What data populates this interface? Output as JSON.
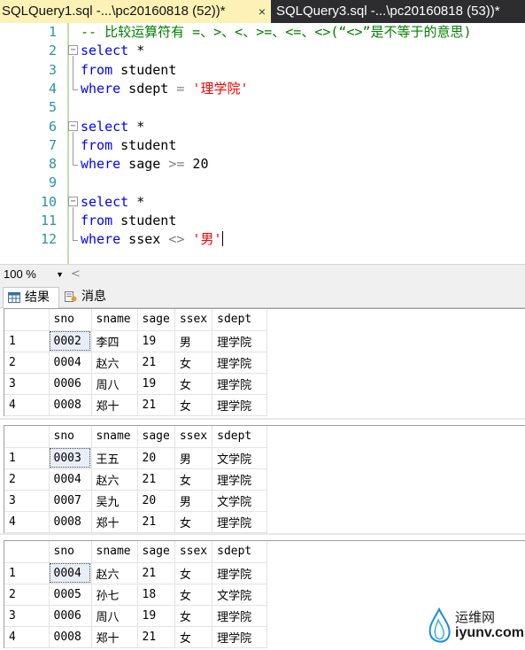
{
  "tabs": {
    "active": "SQLQuery1.sql -...\\pc20160818 (52))*",
    "close": "×",
    "inactive": "SQLQuery3.sql -...\\pc20160818 (53))*"
  },
  "editor": {
    "lines": [
      {
        "n": "1",
        "text": "-- 比较运算符有 =、>、<、>=、<=、<>(“<>”是不等于的意思)"
      },
      {
        "n": "2",
        "kw": "select",
        "rest": " *"
      },
      {
        "n": "3",
        "kw": "from",
        "rest": " student"
      },
      {
        "n": "4",
        "kw": "where",
        "ident": " sdept ",
        "op": "=",
        "str": " '理学院'"
      },
      {
        "n": "5"
      },
      {
        "n": "6",
        "kw": "select",
        "rest": " *"
      },
      {
        "n": "7",
        "kw": "from",
        "rest": " student"
      },
      {
        "n": "8",
        "kw": "where",
        "ident": " sage ",
        "op": ">=",
        "num": " 20"
      },
      {
        "n": "9"
      },
      {
        "n": "10",
        "kw": "select",
        "rest": " *"
      },
      {
        "n": "11",
        "kw": "from",
        "rest": " student"
      },
      {
        "n": "12",
        "kw": "where",
        "ident": " ssex ",
        "op": "<>",
        "str": " '男'"
      }
    ]
  },
  "zoom": {
    "level": "100 %",
    "scroll_left": "<"
  },
  "result_tabs": {
    "results": "结果",
    "messages": "消息"
  },
  "grids": [
    {
      "columns": [
        "sno",
        "sname",
        "sage",
        "ssex",
        "sdept"
      ],
      "rows": [
        [
          "1",
          "0002",
          "李四",
          "19",
          "男",
          "理学院"
        ],
        [
          "2",
          "0004",
          "赵六",
          "21",
          "女",
          "理学院"
        ],
        [
          "3",
          "0006",
          "周八",
          "19",
          "女",
          "理学院"
        ],
        [
          "4",
          "0008",
          "郑十",
          "21",
          "女",
          "理学院"
        ]
      ]
    },
    {
      "columns": [
        "sno",
        "sname",
        "sage",
        "ssex",
        "sdept"
      ],
      "rows": [
        [
          "1",
          "0003",
          "王五",
          "20",
          "男",
          "文学院"
        ],
        [
          "2",
          "0004",
          "赵六",
          "21",
          "女",
          "理学院"
        ],
        [
          "3",
          "0007",
          "吴九",
          "20",
          "男",
          "文学院"
        ],
        [
          "4",
          "0008",
          "郑十",
          "21",
          "女",
          "理学院"
        ]
      ]
    },
    {
      "columns": [
        "sno",
        "sname",
        "sage",
        "ssex",
        "sdept"
      ],
      "rows": [
        [
          "1",
          "0004",
          "赵六",
          "21",
          "女",
          "理学院"
        ],
        [
          "2",
          "0005",
          "孙七",
          "18",
          "女",
          "文学院"
        ],
        [
          "3",
          "0006",
          "周八",
          "19",
          "女",
          "理学院"
        ],
        [
          "4",
          "0008",
          "郑十",
          "21",
          "女",
          "理学院"
        ]
      ]
    }
  ],
  "watermark": {
    "top": "运维网",
    "bottom": "iyunv.com"
  }
}
